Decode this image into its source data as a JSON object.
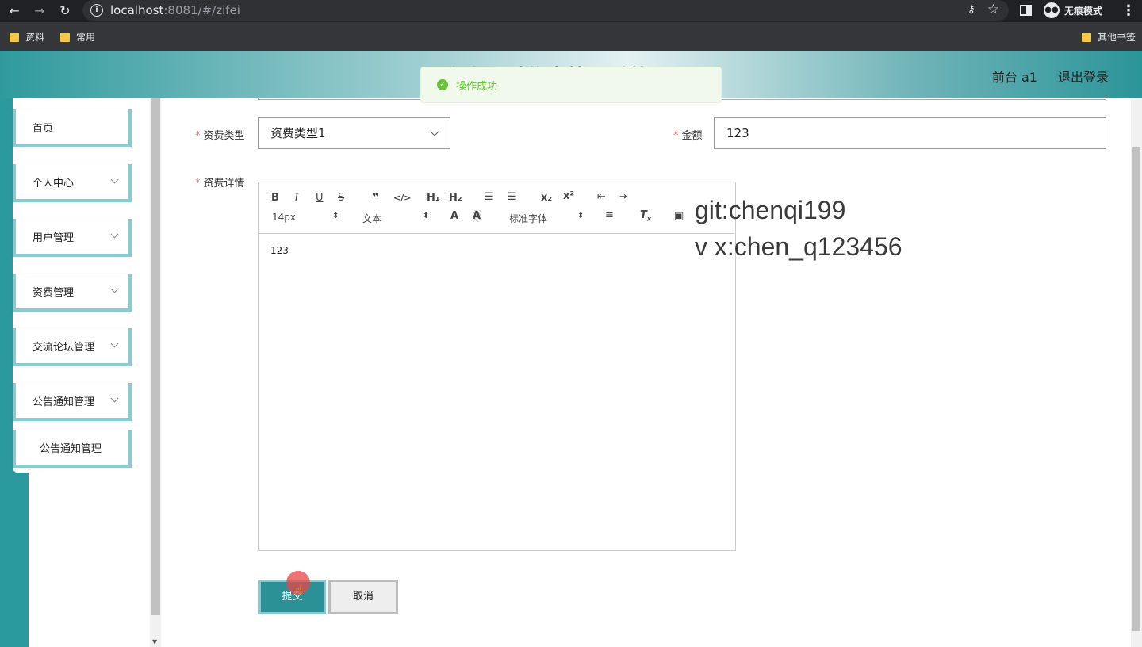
{
  "browser": {
    "url_host": "localhost",
    "url_path": ":8081/#/zifei",
    "incognito_label": "无痕模式",
    "bookmarks": [
      "资料",
      "常用"
    ],
    "other_bookmarks": "其他书签"
  },
  "header": {
    "title": "个人理财信息管理系统",
    "links": [
      "前台 a1",
      "退出登录"
    ]
  },
  "toast": {
    "message": "操作成功",
    "color": "#67c23a"
  },
  "sidebar": {
    "items": [
      {
        "label": "首页"
      },
      {
        "label": "个人中心"
      },
      {
        "label": "用户管理"
      },
      {
        "label": "资费管理"
      },
      {
        "label": "交流论坛管理"
      },
      {
        "label": "公告通知管理"
      },
      {
        "label": "公告通知管理"
      }
    ]
  },
  "form": {
    "type_label": "资费类型",
    "type_value": "资费类型1",
    "amount_label": "金额",
    "amount_value": "123",
    "detail_label": "资费详情",
    "detail_content": "123"
  },
  "editor": {
    "font_size": "14px",
    "text_style": "文本",
    "font_family": "标准字体"
  },
  "watermark": [
    "git:chenqi199",
    "v x:chen_q123456"
  ],
  "buttons": {
    "submit": "提交",
    "cancel": "取消"
  },
  "colors": {
    "accent": "#2c9196",
    "accent_light": "#88c9cd",
    "required": "#f56c6c"
  }
}
